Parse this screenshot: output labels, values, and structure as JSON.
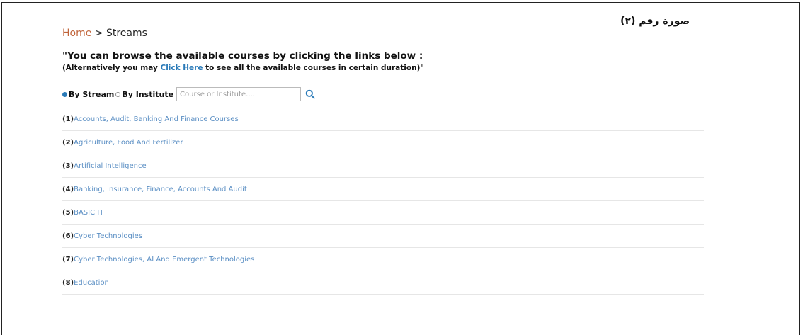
{
  "caption": "صورة رقم (٢)",
  "breadcrumb": {
    "home": "Home",
    "separator": " > ",
    "current": "Streams"
  },
  "intro": {
    "line1": "\"You can browse the available courses by clicking the links below :",
    "line2_prefix": "(Alternatively you may ",
    "line2_link": "Click Here",
    "line2_suffix": " to see all the available courses in certain duration)\""
  },
  "filter": {
    "by_stream_label": "By Stream",
    "by_institute_label": "By Institute",
    "selected": "By Stream",
    "search_placeholder": "Course or Institute....",
    "search_value": ""
  },
  "streams": [
    {
      "num": "(1)",
      "label": "Accounts, Audit, Banking And Finance Courses"
    },
    {
      "num": "(2)",
      "label": "Agriculture, Food And Fertilizer"
    },
    {
      "num": "(3)",
      "label": "Artificial Intelligence"
    },
    {
      "num": "(4)",
      "label": "Banking, Insurance, Finance, Accounts And Audit"
    },
    {
      "num": "(5)",
      "label": "BASIC IT"
    },
    {
      "num": "(6)",
      "label": "Cyber Technologies"
    },
    {
      "num": "(7)",
      "label": "Cyber Technologies, AI And Emergent Technologies"
    },
    {
      "num": "(8)",
      "label": "Education"
    }
  ],
  "colors": {
    "home_link": "#c0643a",
    "link": "#2a7ab8",
    "stream_link": "#5b8fc4"
  },
  "icons": {
    "search": "search-icon"
  }
}
